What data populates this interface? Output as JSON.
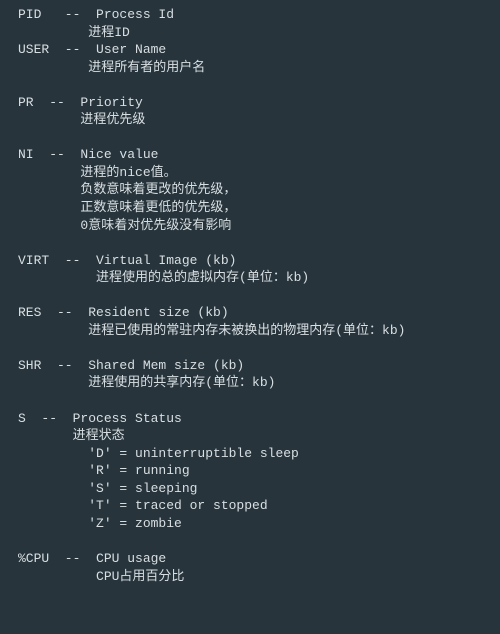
{
  "entries": [
    {
      "key": "PID",
      "pad": 5,
      "indent": 9,
      "title": "Process Id",
      "lines": [
        "进程ID"
      ]
    },
    {
      "key": "USER",
      "pad": 5,
      "indent": 9,
      "title": "User Name",
      "lines": [
        "进程所有者的用户名"
      ],
      "gap_after": true
    },
    {
      "key": "PR",
      "pad": 3,
      "indent": 8,
      "title": "Priority",
      "lines": [
        "进程优先级"
      ],
      "gap_after": true
    },
    {
      "key": "NI",
      "pad": 3,
      "indent": 8,
      "title": "Nice value",
      "lines": [
        "进程的nice值。",
        "负数意味着更改的优先级，",
        "正数意味着更低的优先级，",
        "0意味着对优先级没有影响"
      ],
      "gap_after": true
    },
    {
      "key": "VIRT",
      "pad": 5,
      "indent": 10,
      "title": "Virtual Image (kb)",
      "lines": [
        "进程使用的总的虚拟内存(单位：kb)"
      ],
      "gap_after": true
    },
    {
      "key": "RES",
      "pad": 4,
      "indent": 9,
      "title": "Resident size (kb)",
      "lines": [
        "进程已使用的常驻内存未被换出的物理内存(单位：kb)"
      ],
      "gap_after": true
    },
    {
      "key": "SHR",
      "pad": 4,
      "indent": 9,
      "title": "Shared Mem size (kb)",
      "lines": [
        "进程使用的共享内存(单位：kb)"
      ],
      "gap_after": true
    },
    {
      "key": "S",
      "pad": 2,
      "indent": 7,
      "title": "Process Status",
      "lines": [
        "进程状态",
        "  'D' = uninterruptible sleep",
        "  'R' = running",
        "  'S' = sleeping",
        "  'T' = traced or stopped",
        "  'Z' = zombie"
      ],
      "gap_after": true
    },
    {
      "key": "%CPU",
      "pad": 5,
      "indent": 10,
      "title": "CPU usage",
      "lines": [
        "CPU占用百分比"
      ]
    }
  ],
  "separator": " --  "
}
